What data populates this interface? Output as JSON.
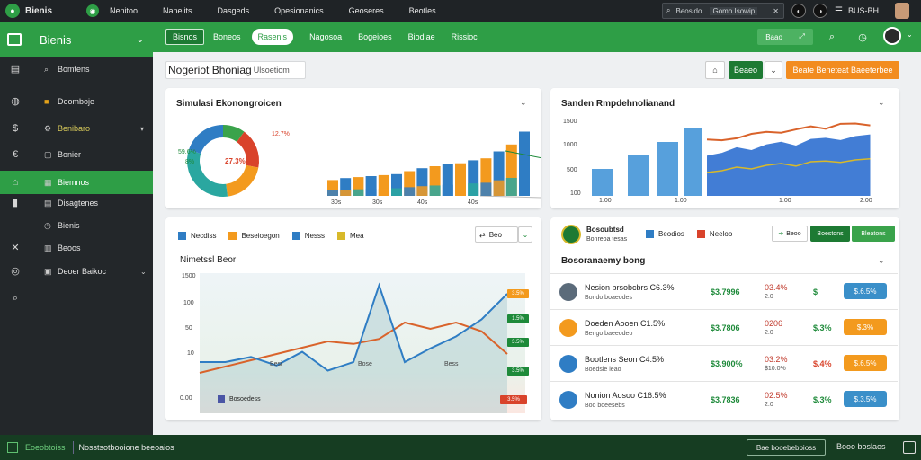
{
  "topbar": {
    "brand": "Bienis",
    "menu": [
      "Nenitoo",
      "Nanelits",
      "Dasgeds",
      "Opesionanics",
      "Geoseres",
      "Beotles"
    ],
    "search_placeholder": "Beosido",
    "search_tag": "Gomo Isowip",
    "user": "BUS-BH"
  },
  "sidebar": {
    "title": "Bienis",
    "items": [
      {
        "label": "Bomtens"
      },
      {
        "label": "Deomboje"
      },
      {
        "label": "Benibaro"
      },
      {
        "label": "Bonier"
      },
      {
        "label": "Biemnos"
      },
      {
        "label": "Disagtenes"
      },
      {
        "label": "Bienis"
      },
      {
        "label": "Beoos"
      },
      {
        "label": "Deoer Baikoc"
      }
    ]
  },
  "subbar": {
    "pill_dark": "Bisnos",
    "nav_first": "Boneos",
    "pill_white": "Rasenis",
    "nav": [
      "Nagosoa",
      "Bogeioes",
      "Biodiae",
      "Rissioc"
    ],
    "right_btn": "Baao"
  },
  "page": {
    "title": "Nogeriot Bhoniag",
    "title_sub": "Ulsoetiom",
    "green_btn": "Beaeo",
    "orange_btn": "Beate Beneteat Baeeterbee"
  },
  "card1": {
    "title": "Simulasi Ekonongroicen",
    "donut_center": "27.3%",
    "donut_left1": "59.6%",
    "donut_left2": "8%",
    "donut_right": "12.7%",
    "xticks": [
      "30s",
      "30s",
      "40s",
      "40s"
    ],
    "colors": {
      "green": "#3aa34b",
      "red": "#d9432b",
      "orange": "#f39a1e",
      "teal": "#2aa7a0",
      "blue": "#2f7dc4"
    }
  },
  "card1_chart": {
    "type": "bar",
    "values": [
      16,
      18,
      19,
      20,
      21,
      22,
      25,
      28,
      30,
      32,
      33,
      36,
      38,
      45,
      52,
      65
    ]
  },
  "card2": {
    "title": "Sanden Rmpdehnolianand",
    "yticks": [
      "1500",
      "1000",
      "500",
      "100"
    ],
    "xticks": [
      "1.00",
      "1.00",
      "1.00",
      "2.00"
    ]
  },
  "card2_chart": {
    "type": "area",
    "bars": [
      30,
      45,
      60,
      75
    ],
    "line": [
      40,
      45,
      55,
      50,
      60,
      65,
      58,
      70,
      72,
      68,
      75,
      78
    ]
  },
  "card3": {
    "legend": [
      {
        "name": "Necdiss",
        "color": "#2f7dc4"
      },
      {
        "name": "Beseioegon",
        "color": "#f39a1e"
      },
      {
        "name": "Nesss",
        "color": "#2f7dc4"
      },
      {
        "name": "Mea",
        "color": "#d8b92a"
      }
    ],
    "dropdown": "Beo",
    "subtitle": "Nimetssl Beor",
    "yticks": [
      "1500",
      "100",
      "50",
      "10",
      "0.00"
    ],
    "xticks": [
      "Besi",
      "Bose",
      "Bess"
    ],
    "bottom_legend": "Bosoedess",
    "tags": [
      {
        "label": "3.5%",
        "color": "#f39a1e"
      },
      {
        "label": "1.5%",
        "color": "#1e8a3a"
      },
      {
        "label": "3.5%",
        "color": "#1e8a3a"
      },
      {
        "label": "3.5%",
        "color": "#1e8a3a"
      },
      {
        "label": "3.5%",
        "color": "#d9432b"
      }
    ]
  },
  "card3_chart": {
    "type": "line",
    "blue": [
      30,
      30,
      33,
      28,
      36,
      25,
      30,
      75,
      30,
      38,
      45,
      55,
      70
    ],
    "orange": [
      75,
      70,
      65,
      60,
      55,
      50,
      52,
      48,
      35,
      40,
      35,
      42,
      60
    ]
  },
  "card4": {
    "head_label": "Bosoubtsd",
    "head_sub": "Bonreoa tesas",
    "legend": [
      {
        "name": "Beodios",
        "color": "#2f7dc4"
      },
      {
        "name": "Neeloo",
        "color": "#d9432b"
      }
    ],
    "btn1": "Beoo",
    "btn2": "Boestons",
    "btn3": "Bleatons",
    "title": "Bosoranaemy bong",
    "rows": [
      {
        "name": "Nesion brsobcbrs C6.3%",
        "sub": "Bondo boaeodes",
        "v1": "$3.7996",
        "v2": "03.4%",
        "v2b": "2.0",
        "v3": "$",
        "btn": "$.6.5%",
        "btn_color": "#3a8fc9",
        "ava": "#5b6b7a"
      },
      {
        "name": "Doeden Aooen C1.5%",
        "sub": "Bengo baeeodeo",
        "v1": "$3.7806",
        "v2": "0206",
        "v2b": "2.0",
        "v3": "$.3%",
        "btn": "$.3%",
        "btn_color": "#f39a1e",
        "ava": "#f39a1e"
      },
      {
        "name": "Bootlens Seon C4.5%",
        "sub": "Boedsie ieao",
        "v1": "$3.900%",
        "v2": "03.2%",
        "v2b": "$10.0%",
        "v3": "$.4%",
        "btn": "$.6.5%",
        "btn_color": "#f39a1e",
        "ava": "#2f7dc4"
      },
      {
        "name": "Nonion Aosoo C16.5%",
        "sub": "Boo boeesebs",
        "v1": "$3.7836",
        "v2": "02.5%",
        "v2b": "2.0",
        "v3": "$.3%",
        "btn": "$.3.5%",
        "btn_color": "#3a8fc9",
        "ava": "#2f7dc4"
      }
    ]
  },
  "footer": {
    "left": "Eoeobtoiss",
    "middle": "Nosstsotbooione beeoaios",
    "btn": "Bae booebebbioss",
    "right": "Booo boslaos"
  }
}
